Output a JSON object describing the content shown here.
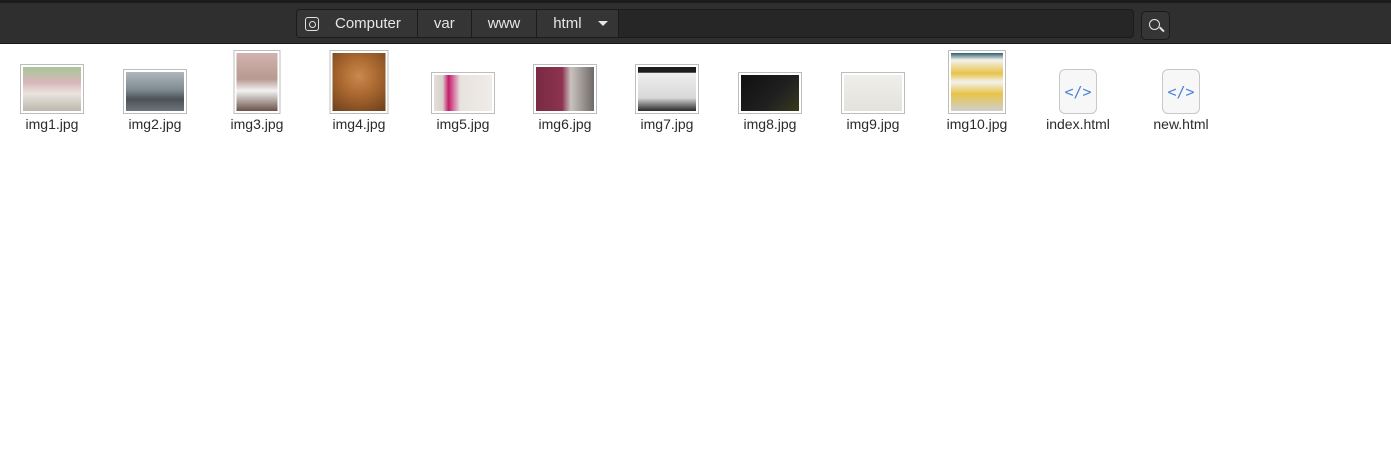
{
  "pathbar": {
    "root_label": "Computer",
    "crumbs": [
      "var",
      "www",
      "html"
    ],
    "root_icon": "drive-icon",
    "dropdown_icon": "caret-down-icon"
  },
  "search": {
    "icon": "search-icon"
  },
  "files": [
    {
      "name": "img1.jpg",
      "kind": "image"
    },
    {
      "name": "img2.jpg",
      "kind": "image"
    },
    {
      "name": "img3.jpg",
      "kind": "image"
    },
    {
      "name": "img4.jpg",
      "kind": "image"
    },
    {
      "name": "img5.jpg",
      "kind": "image"
    },
    {
      "name": "img6.jpg",
      "kind": "image"
    },
    {
      "name": "img7.jpg",
      "kind": "image"
    },
    {
      "name": "img8.jpg",
      "kind": "image"
    },
    {
      "name": "img9.jpg",
      "kind": "image"
    },
    {
      "name": "img10.jpg",
      "kind": "image"
    },
    {
      "name": "index.html",
      "kind": "html",
      "icon_glyph": "</>"
    },
    {
      "name": "new.html",
      "kind": "html",
      "icon_glyph": "</>"
    }
  ],
  "colors": {
    "header_bg": "#2f2f2f",
    "pathbar_bg": "#262626",
    "crumb_bg": "#353535",
    "html_icon_accent": "#4a83d8"
  }
}
